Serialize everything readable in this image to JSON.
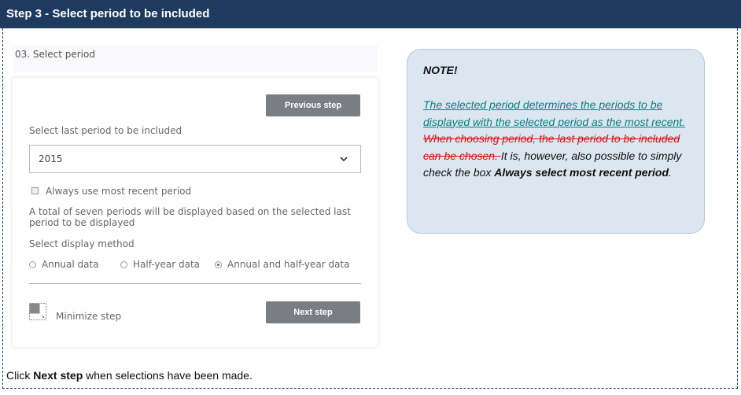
{
  "header": {
    "title": "Step 3 - Select period to be included"
  },
  "step": {
    "label": "03. Select period",
    "previous_button": "Previous step",
    "last_period_label": "Select last period to be included",
    "last_period_value": "2015",
    "always_recent_label": "Always use most recent period",
    "always_recent_checked": false,
    "info_text": "A total of seven periods will be displayed based on the selected last period to be displayed",
    "display_method_label": "Select display method",
    "display_options": [
      {
        "label": "Annual data",
        "selected": false
      },
      {
        "label": "Half-year data",
        "selected": false
      },
      {
        "label": "Annual and half-year data",
        "selected": true
      }
    ],
    "minimize_label": "Minimize step",
    "next_button": "Next step"
  },
  "note": {
    "title": "NOTE!",
    "inserted_text": "The selected period determines the periods to be displayed with the selected period as the most recent. ",
    "deleted_text": "When choosing period, the last period to be included can be chosen. ",
    "body_text": "It is, however, also possible to simply check the box ",
    "emphasis_text": "Always select most recent period",
    "end_text": "."
  },
  "footer": {
    "prefix": "Click ",
    "bold": "Next step",
    "suffix": " when selections have been made."
  },
  "colors": {
    "header_bg": "#1f3a5f",
    "button_bg": "#7a7d84",
    "note_bg": "#dce6f1",
    "inserted_text": "#0a7f7f",
    "deleted_text": "#dd1111"
  },
  "icons": {
    "select_chevron": "chevron-down-icon",
    "minimize": "minimize-icon"
  }
}
